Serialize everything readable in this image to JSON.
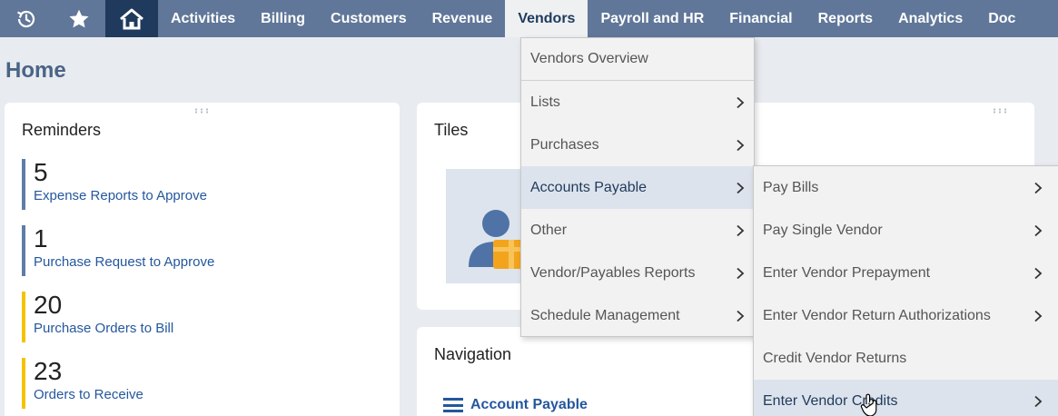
{
  "nav": {
    "items": [
      "Activities",
      "Billing",
      "Customers",
      "Revenue",
      "Vendors",
      "Payroll and HR",
      "Financial",
      "Reports",
      "Analytics",
      "Doc"
    ],
    "active_index": 4,
    "icons": [
      "history-icon",
      "star-icon",
      "home-icon"
    ]
  },
  "page": {
    "title": "Home"
  },
  "reminders": {
    "title": "Reminders",
    "items": [
      {
        "count": "5",
        "label": "Expense Reports to Approve",
        "color": "#5e7ea5"
      },
      {
        "count": "1",
        "label": "Purchase Request to Approve",
        "color": "#5e7ea5"
      },
      {
        "count": "20",
        "label": "Purchase Orders to Bill",
        "color": "#f4c300"
      },
      {
        "count": "23",
        "label": "Orders to Receive",
        "color": "#f4c300"
      }
    ]
  },
  "tiles": {
    "title": "Tiles"
  },
  "navigation": {
    "title": "Navigation",
    "link": "Account Payable"
  },
  "vendors_menu": {
    "items": [
      {
        "label": "Vendors Overview",
        "submenu": false
      },
      {
        "label": "Lists",
        "submenu": true
      },
      {
        "label": "Purchases",
        "submenu": true
      },
      {
        "label": "Accounts Payable",
        "submenu": true
      },
      {
        "label": "Other",
        "submenu": true
      },
      {
        "label": "Vendor/Payables Reports",
        "submenu": true
      },
      {
        "label": "Schedule Management",
        "submenu": true
      }
    ]
  },
  "ap_menu": {
    "items": [
      {
        "label": "Pay Bills",
        "submenu": true
      },
      {
        "label": "Pay Single Vendor",
        "submenu": true
      },
      {
        "label": "Enter Vendor Prepayment",
        "submenu": true
      },
      {
        "label": "Enter Vendor Return Authorizations",
        "submenu": true
      },
      {
        "label": "Credit Vendor Returns",
        "submenu": false
      },
      {
        "label": "Enter Vendor Credits",
        "submenu": true
      }
    ]
  },
  "colors": {
    "nav_bg": "#607799",
    "home_bg": "#1f3a5c",
    "link": "#24579d",
    "highlight": "#dde3ec"
  }
}
